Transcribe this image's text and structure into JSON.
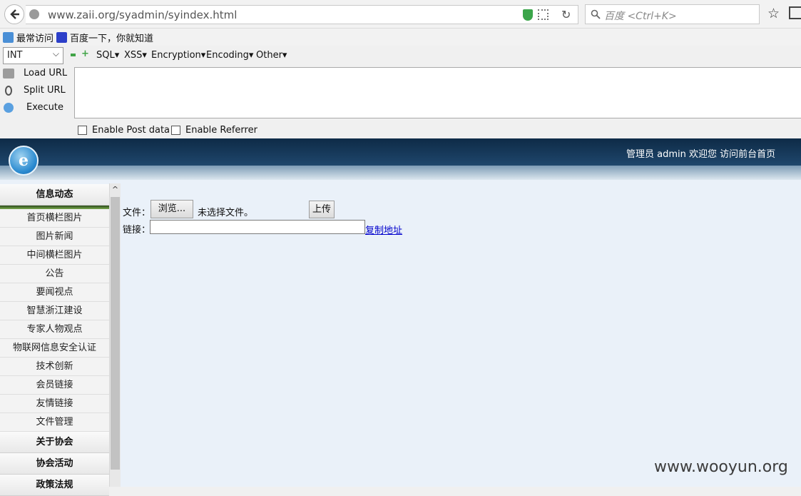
{
  "browser": {
    "url": "www.zaii.org/syadmin/syindex.html",
    "search_placeholder": "百度 <Ctrl+K>"
  },
  "bookmarks": [
    {
      "label": "最常访问"
    },
    {
      "label": "百度一下，你就知道"
    }
  ],
  "hackbar": {
    "select_value": "INT",
    "menus": [
      "SQL",
      "XSS",
      "Encryption",
      "Encoding",
      "Other"
    ],
    "load_url": "Load URL",
    "split_url": "Split URL",
    "execute": "Execute",
    "enable_post": "Enable Post data",
    "enable_referrer": "Enable Referrer"
  },
  "site": {
    "logo_glyph": "e",
    "greeting": "管理员 admin 欢迎您 访问前台首页"
  },
  "sidebar": {
    "section_active": "信息动态",
    "items": [
      "首页横栏图片",
      "图片新闻",
      "中间横栏图片",
      "公告",
      "要闻视点",
      "智慧浙江建设",
      "专家人物观点",
      "物联网信息安全认证",
      "技术创新",
      "会员链接",
      "友情链接",
      "文件管理"
    ],
    "sections": [
      "关于协会",
      "协会活动",
      "政策法规"
    ]
  },
  "form": {
    "file_label": "文件：",
    "browse_button": "浏览...",
    "file_status": "未选择文件。",
    "upload_button": "上传",
    "link_label": "链接：",
    "link_value": "",
    "copy_link": "复制地址"
  },
  "watermark": "www.wooyun.org"
}
